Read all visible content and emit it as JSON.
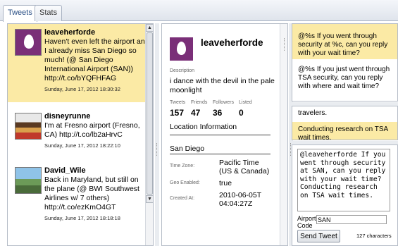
{
  "tabs": [
    {
      "label": "Tweets",
      "active": true
    },
    {
      "label": "Stats",
      "active": false
    }
  ],
  "tweets": [
    {
      "username": "leaveherforde",
      "text": "Haven't even left the airport and I already miss San Diego so much! (@ San Diego International Airport (SAN)) http://t.co/bYQFHFAG",
      "date": "Sunday, June 17, 2012 18:30:32",
      "avatar": "egg-avatar",
      "selected": true
    },
    {
      "username": "disneyrunne",
      "text": "I'm at Fresno airport (Fresno, CA) http://t.co/lb2aHrvC",
      "date": "Sunday, June 17, 2012 18:22:10",
      "avatar": "photo-avatar"
    },
    {
      "username": "David_Wile",
      "text": "Back in Maryland, but still on the plane (@ BWI Southwest Airlines w/ 7 others) http://t.co/ezKmO4GT",
      "date": "Sunday, June 17, 2012 18:18:18",
      "avatar": "photo-avatar"
    }
  ],
  "profile": {
    "username": "leaveherforde",
    "description_label": "Description",
    "description": "i dance with the devil in the pale moonlight",
    "stats": [
      {
        "label": "Tweets",
        "value": "157"
      },
      {
        "label": "Friends",
        "value": "47"
      },
      {
        "label": "Followers",
        "value": "36"
      },
      {
        "label": "Listed",
        "value": "0"
      }
    ],
    "location_heading": "Location Information",
    "location": "San Diego",
    "time_zone_label": "Time Zone:",
    "time_zone": "Pacific Time (US & Canada)",
    "geo_label": "Geo Enabled:",
    "geo": "true",
    "created_label": "Created At:",
    "created": "2010-06-05T04:04:27Z"
  },
  "templates_top": [
    {
      "text": "@%s If you went through security at %c, can you reply with your wait time?",
      "selected": true
    },
    {
      "text": "@%s If you just went through TSA security, can you reply with where and wait time?",
      "selected": false
    }
  ],
  "templates_mid": [
    {
      "text": "travelers.",
      "selected": false
    },
    {
      "text": "Conducting research on TSA wait times.",
      "selected": true
    }
  ],
  "reply": {
    "text": "@leaveherforde If you went through security at SAN, can you reply with your wait time? Conducting research on TSA wait times.",
    "airport_label": "Airport Code",
    "airport_code": "SAN",
    "send_label": "Send Tweet",
    "char_count": "127 characters"
  }
}
